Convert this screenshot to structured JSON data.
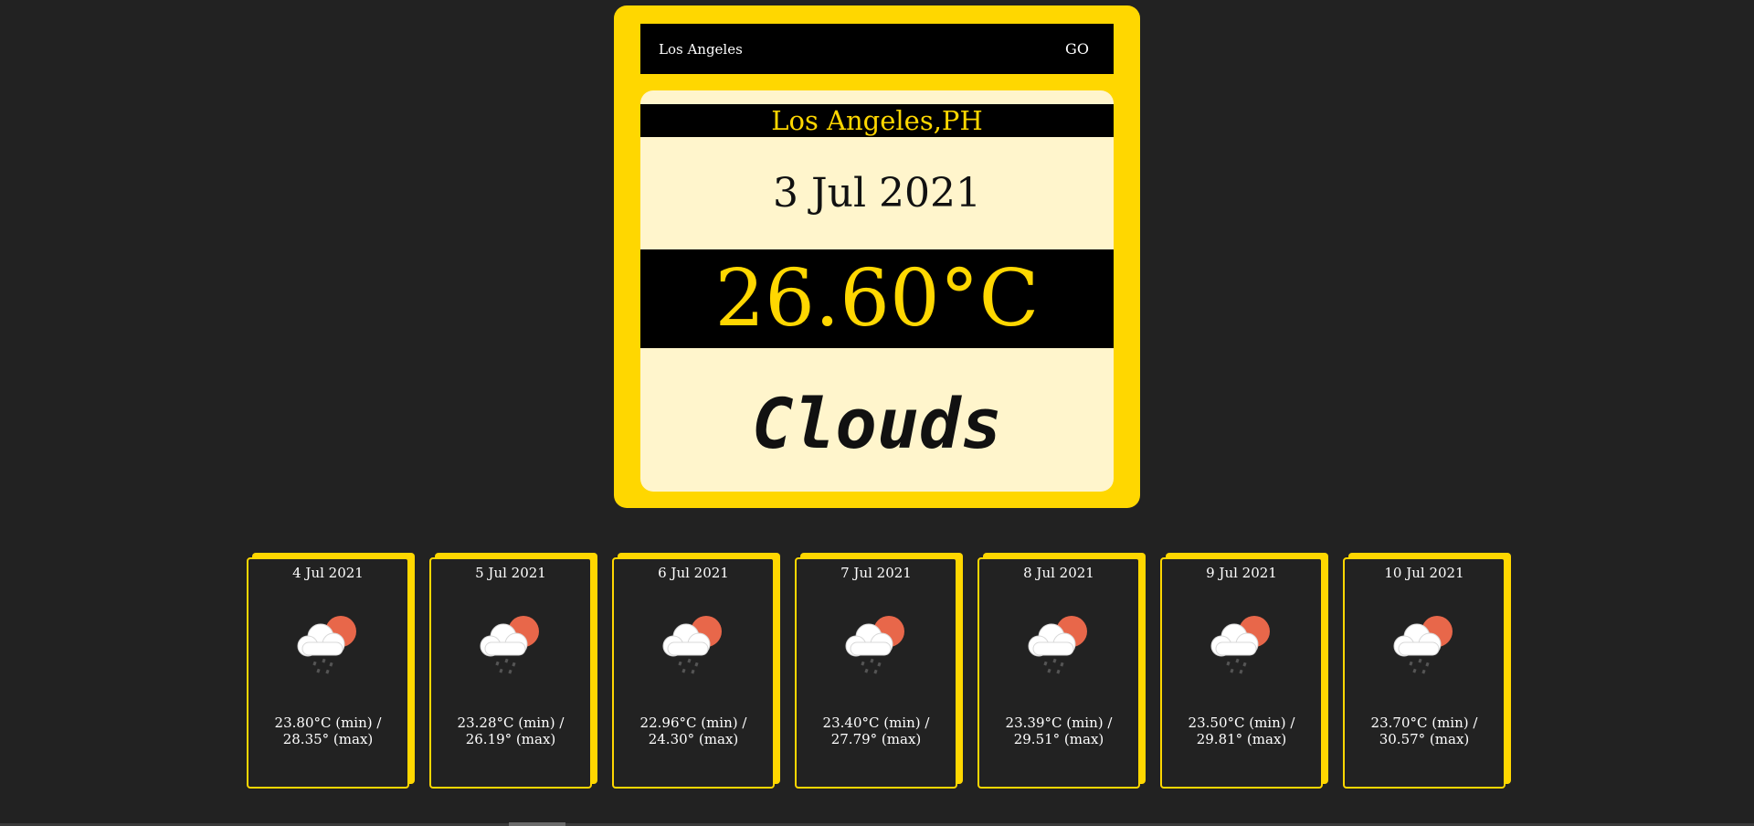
{
  "search": {
    "value": "Los Angeles",
    "go_label": "GO"
  },
  "current": {
    "location": "Los Angeles,PH",
    "date": "3 Jul 2021",
    "temperature": "26.60°C",
    "condition": "Clouds"
  },
  "colors": {
    "accent": "#FFD700",
    "background": "#222222",
    "panel": "#FFF5CC",
    "sun": "#E8674A"
  },
  "forecast": [
    {
      "date": "4 Jul 2021",
      "icon": "cloud-sun-rain-icon",
      "temp": "23.80°C (min) / 28.35° (max)"
    },
    {
      "date": "5 Jul 2021",
      "icon": "cloud-sun-rain-icon",
      "temp": "23.28°C (min) / 26.19° (max)"
    },
    {
      "date": "6 Jul 2021",
      "icon": "cloud-sun-rain-icon",
      "temp": "22.96°C (min) / 24.30° (max)"
    },
    {
      "date": "7 Jul 2021",
      "icon": "cloud-sun-rain-icon",
      "temp": "23.40°C (min) / 27.79° (max)"
    },
    {
      "date": "8 Jul 2021",
      "icon": "cloud-sun-rain-icon",
      "temp": "23.39°C (min) / 29.51° (max)"
    },
    {
      "date": "9 Jul 2021",
      "icon": "cloud-sun-rain-icon",
      "temp": "23.50°C (min) / 29.81° (max)"
    },
    {
      "date": "10 Jul 2021",
      "icon": "cloud-sun-rain-icon",
      "temp": "23.70°C (min) / 30.57° (max)"
    }
  ]
}
